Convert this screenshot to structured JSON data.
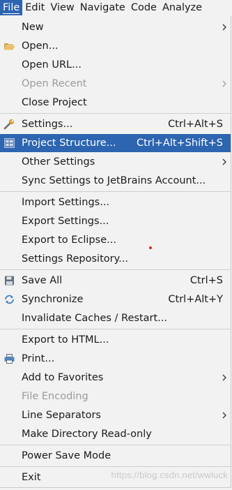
{
  "menubar": {
    "file": "File",
    "edit": "Edit",
    "view": "View",
    "navigate": "Navigate",
    "code": "Code",
    "analyze": "Analyze"
  },
  "menu": {
    "new": {
      "label": "New"
    },
    "open": {
      "label": "Open..."
    },
    "open_url": {
      "label": "Open URL..."
    },
    "open_recent": {
      "label": "Open Recent"
    },
    "close_project": {
      "label": "Close Project"
    },
    "settings": {
      "label": "Settings...",
      "shortcut": "Ctrl+Alt+S"
    },
    "project_structure": {
      "label": "Project Structure...",
      "shortcut": "Ctrl+Alt+Shift+S"
    },
    "other_settings": {
      "label": "Other Settings"
    },
    "sync_settings": {
      "label": "Sync Settings to JetBrains Account..."
    },
    "import_settings": {
      "label": "Import Settings..."
    },
    "export_settings": {
      "label": "Export Settings..."
    },
    "export_eclipse": {
      "label": "Export to Eclipse..."
    },
    "settings_repository": {
      "label": "Settings Repository..."
    },
    "save_all": {
      "label": "Save All",
      "shortcut": "Ctrl+S"
    },
    "synchronize": {
      "label": "Synchronize",
      "shortcut": "Ctrl+Alt+Y"
    },
    "invalidate_caches": {
      "label": "Invalidate Caches / Restart..."
    },
    "export_html": {
      "label": "Export to HTML..."
    },
    "print": {
      "label": "Print..."
    },
    "add_favorites": {
      "label": "Add to Favorites"
    },
    "file_encoding": {
      "label": "File Encoding"
    },
    "line_separators": {
      "label": "Line Separators"
    },
    "make_readonly": {
      "label": "Make Directory Read-only"
    },
    "power_save": {
      "label": "Power Save Mode"
    },
    "exit": {
      "label": "Exit"
    }
  },
  "watermark": "https://blog.csdn.net/wwluck",
  "colors": {
    "selection": "#2d65b0",
    "background": "#f2f2f2",
    "disabled": "#9a9a9a"
  }
}
